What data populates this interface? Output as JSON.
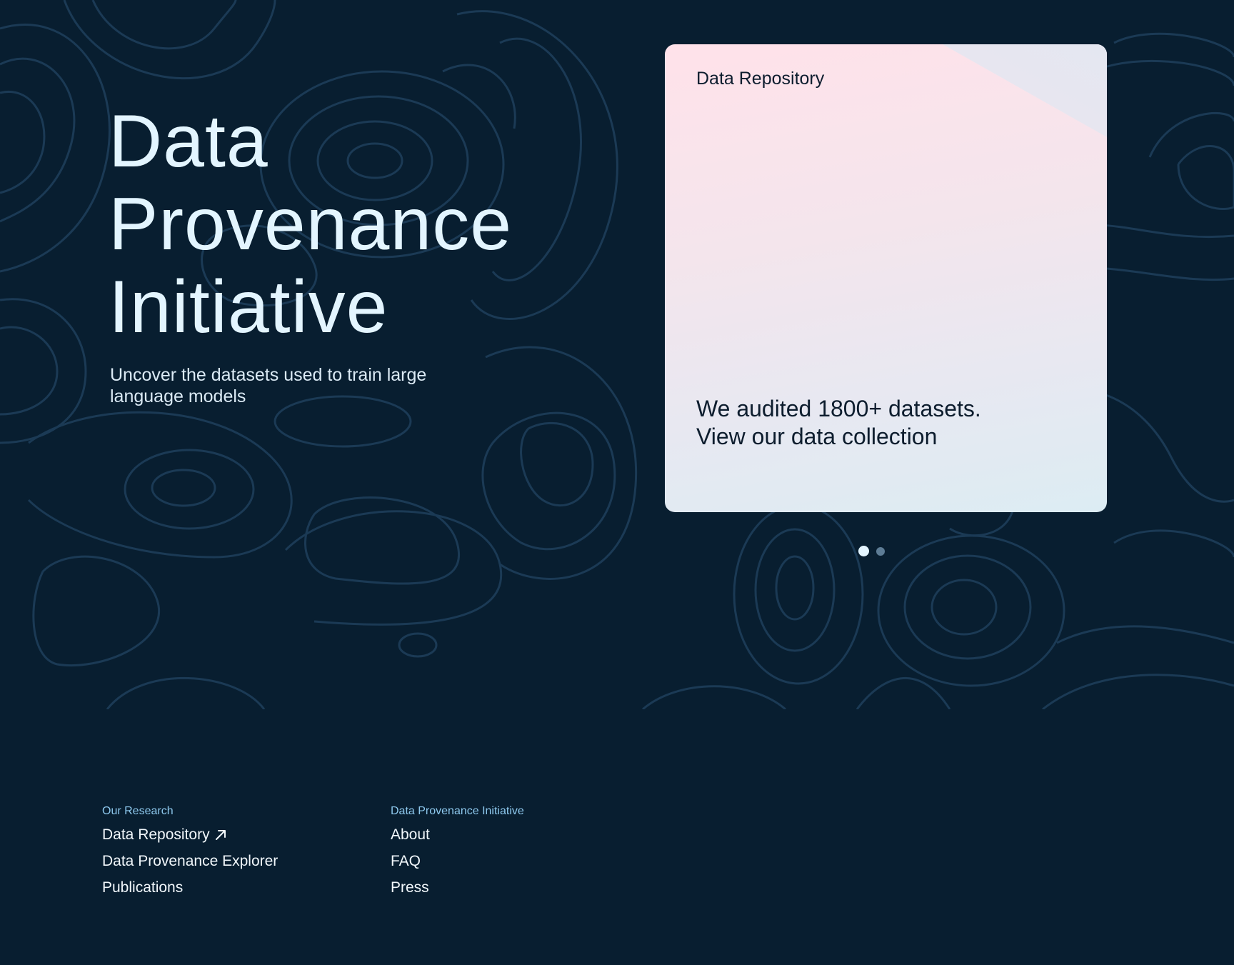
{
  "hero": {
    "title_lines": [
      "Data",
      "Provenance",
      "Initiative"
    ],
    "subtitle": "Uncover the datasets used to train large language models"
  },
  "card": {
    "label": "Data Repository",
    "text": "We audited 1800+ datasets. View our data collection"
  },
  "carousel": {
    "slides": 2,
    "active_index": 0
  },
  "footer": {
    "research": {
      "heading": "Our Research",
      "links": [
        {
          "label": "Data Repository",
          "icon": "external-arrow-icon"
        },
        {
          "label": "Data Provenance Explorer"
        },
        {
          "label": "Publications"
        }
      ]
    },
    "initiative": {
      "heading": "Data Provenance Initiative",
      "links": [
        {
          "label": "About"
        },
        {
          "label": "FAQ"
        },
        {
          "label": "Press"
        }
      ]
    }
  },
  "colors": {
    "background": "#081e30",
    "contour": "#1b3a55",
    "title": "#e3f5ff",
    "footer_heading": "#8ec9ee",
    "card_text": "#0d1d2e"
  }
}
